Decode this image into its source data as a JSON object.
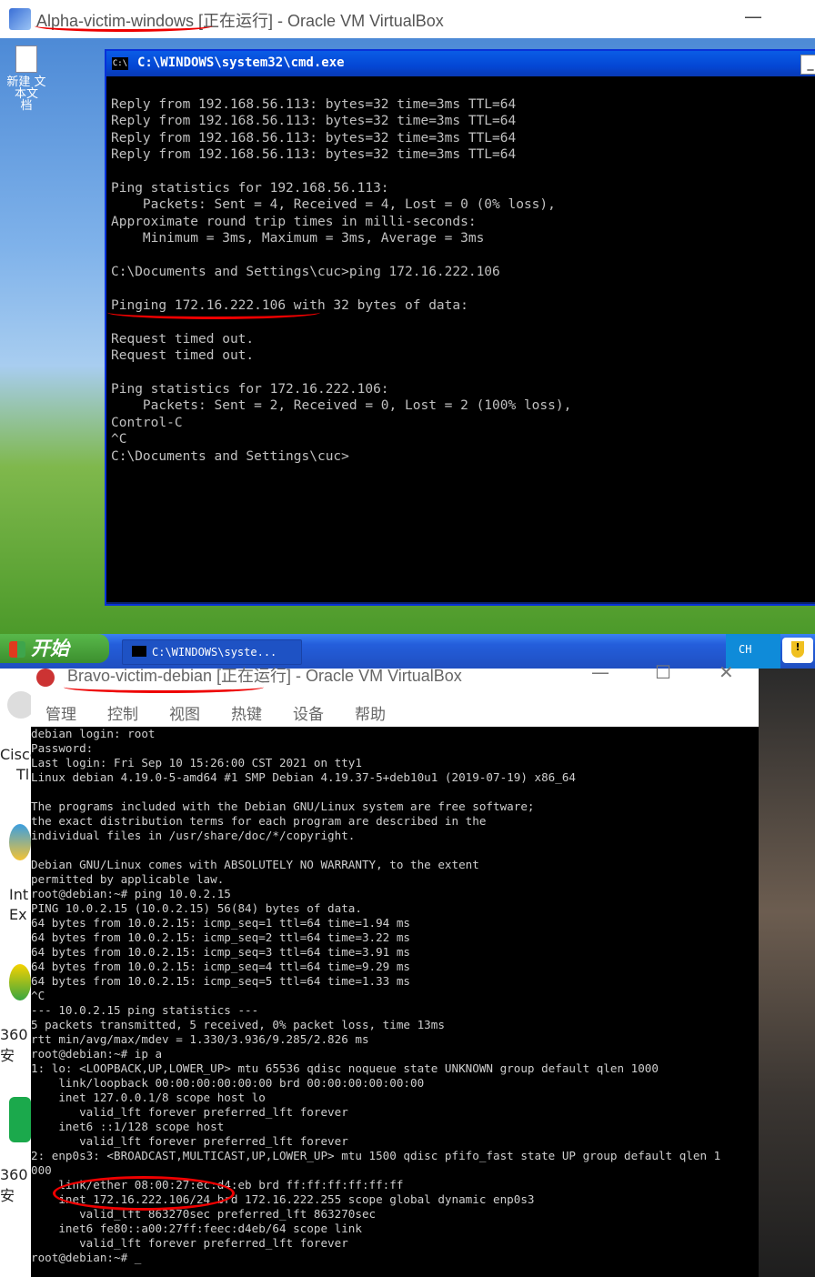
{
  "top_window": {
    "title": "Alpha-victim-windows [正在运行] - Oracle VM VirtualBox",
    "minimize": "—"
  },
  "desktop": {
    "icon_label": "新建 文本文\n档"
  },
  "cmd": {
    "title": "C:\\WINDOWS\\system32\\cmd.exe",
    "icon": "C:\\",
    "lines": [
      "Reply from 192.168.56.113: bytes=32 time=3ms TTL=64",
      "Reply from 192.168.56.113: bytes=32 time=3ms TTL=64",
      "Reply from 192.168.56.113: bytes=32 time=3ms TTL=64",
      "Reply from 192.168.56.113: bytes=32 time=3ms TTL=64",
      "",
      "Ping statistics for 192.168.56.113:",
      "    Packets: Sent = 4, Received = 4, Lost = 0 (0% loss),",
      "Approximate round trip times in milli-seconds:",
      "    Minimum = 3ms, Maximum = 3ms, Average = 3ms",
      "",
      "C:\\Documents and Settings\\cuc>ping 172.16.222.106",
      "",
      "Pinging 172.16.222.106 with 32 bytes of data:",
      "",
      "Request timed out.",
      "Request timed out.",
      "",
      "Ping statistics for 172.16.222.106:",
      "    Packets: Sent = 2, Received = 0, Lost = 2 (100% loss),",
      "Control-C",
      "^C",
      "C:\\Documents and Settings\\cuc>"
    ]
  },
  "taskbar": {
    "start_label": "开始",
    "task_item": "C:\\WINDOWS\\syste...",
    "lang": "CH"
  },
  "bottom_window": {
    "title": "Bravo-victim-debian [正在运行] - Oracle VM VirtualBox",
    "menu": [
      "管理",
      "控制",
      "视图",
      "热键",
      "设备",
      "帮助"
    ]
  },
  "left_stubs": [
    "Cisco",
    "Tl",
    "Int",
    "Ex",
    "360安",
    "360安"
  ],
  "terminal": {
    "lines": [
      "debian login: root",
      "Password:",
      "Last login: Fri Sep 10 15:26:00 CST 2021 on tty1",
      "Linux debian 4.19.0-5-amd64 #1 SMP Debian 4.19.37-5+deb10u1 (2019-07-19) x86_64",
      "",
      "The programs included with the Debian GNU/Linux system are free software;",
      "the exact distribution terms for each program are described in the",
      "individual files in /usr/share/doc/*/copyright.",
      "",
      "Debian GNU/Linux comes with ABSOLUTELY NO WARRANTY, to the extent",
      "permitted by applicable law.",
      "root@debian:~# ping 10.0.2.15",
      "PING 10.0.2.15 (10.0.2.15) 56(84) bytes of data.",
      "64 bytes from 10.0.2.15: icmp_seq=1 ttl=64 time=1.94 ms",
      "64 bytes from 10.0.2.15: icmp_seq=2 ttl=64 time=3.22 ms",
      "64 bytes from 10.0.2.15: icmp_seq=3 ttl=64 time=3.91 ms",
      "64 bytes from 10.0.2.15: icmp_seq=4 ttl=64 time=9.29 ms",
      "64 bytes from 10.0.2.15: icmp_seq=5 ttl=64 time=1.33 ms",
      "^C",
      "--- 10.0.2.15 ping statistics ---",
      "5 packets transmitted, 5 received, 0% packet loss, time 13ms",
      "rtt min/avg/max/mdev = 1.330/3.936/9.285/2.826 ms",
      "root@debian:~# ip a",
      "1: lo: <LOOPBACK,UP,LOWER_UP> mtu 65536 qdisc noqueue state UNKNOWN group default qlen 1000",
      "    link/loopback 00:00:00:00:00:00 brd 00:00:00:00:00:00",
      "    inet 127.0.0.1/8 scope host lo",
      "       valid_lft forever preferred_lft forever",
      "    inet6 ::1/128 scope host",
      "       valid_lft forever preferred_lft forever",
      "2: enp0s3: <BROADCAST,MULTICAST,UP,LOWER_UP> mtu 1500 qdisc pfifo_fast state UP group default qlen 1",
      "000",
      "    link/ether 08:00:27:ec:d4:eb brd ff:ff:ff:ff:ff:ff",
      "    inet 172.16.222.106/24 brd 172.16.222.255 scope global dynamic enp0s3",
      "       valid_lft 863270sec preferred_lft 863270sec",
      "    inet6 fe80::a00:27ff:feec:d4eb/64 scope link",
      "       valid_lft forever preferred_lft forever",
      "root@debian:~# _"
    ]
  }
}
